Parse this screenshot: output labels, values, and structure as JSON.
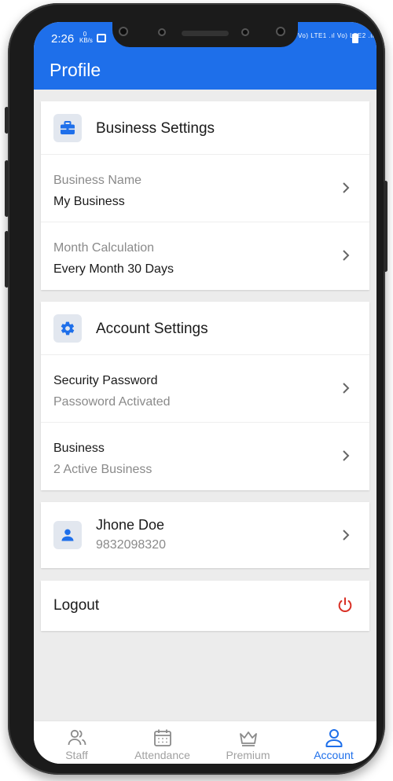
{
  "status_bar": {
    "time": "2:26",
    "speed": "0 KB/s",
    "network": "Vo) LTE1 .ıl Vo) LTE2 .ıl"
  },
  "app_bar": {
    "title": "Profile"
  },
  "business_settings": {
    "title": "Business Settings",
    "icon": "briefcase-icon",
    "rows": [
      {
        "label": "Business Name",
        "value": "My Business"
      },
      {
        "label": "Month Calculation",
        "value": "Every Month 30 Days"
      }
    ]
  },
  "account_settings": {
    "title": "Account Settings",
    "icon": "gear-icon",
    "rows": [
      {
        "title": "Security Password",
        "subtitle": "Passoword Activated"
      },
      {
        "title": "Business",
        "subtitle": "2 Active Business"
      }
    ]
  },
  "user": {
    "name": "Jhone Doe",
    "phone": "9832098320",
    "icon": "person-icon"
  },
  "logout": {
    "label": "Logout",
    "icon": "power-icon"
  },
  "bottom_nav": {
    "items": [
      {
        "label": "Staff",
        "icon": "people-icon",
        "active": false
      },
      {
        "label": "Attendance",
        "icon": "calendar-icon",
        "active": false
      },
      {
        "label": "Premium",
        "icon": "crown-icon",
        "active": false
      },
      {
        "label": "Account",
        "icon": "account-icon",
        "active": true
      }
    ]
  },
  "colors": {
    "primary": "#1e6fea",
    "danger": "#d93025",
    "background": "#ececec",
    "icon_bg": "#e2e7ef"
  }
}
